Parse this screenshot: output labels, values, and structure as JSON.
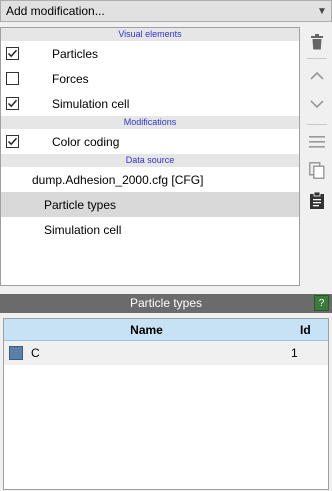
{
  "modifier_dropdown": {
    "label": "Add modification..."
  },
  "pipeline": {
    "visual_header": "Visual elements",
    "visual_items": [
      {
        "label": "Particles",
        "checked": true
      },
      {
        "label": "Forces",
        "checked": false
      },
      {
        "label": "Simulation cell",
        "checked": true
      }
    ],
    "modifications_header": "Modifications",
    "modification_items": [
      {
        "label": "Color coding",
        "checked": true
      }
    ],
    "data_source_header": "Data source",
    "source_file": "dump.Adhesion_2000.cfg [CFG]",
    "source_subitems": [
      {
        "label": "Particle types",
        "selected": true
      },
      {
        "label": "Simulation cell",
        "selected": false
      }
    ]
  },
  "toolbar": {
    "icons": [
      "trash-icon",
      "move-up-icon",
      "move-down-icon",
      "list-menu-icon",
      "copy-icon",
      "clipboard-icon"
    ]
  },
  "panel": {
    "title": "Particle types",
    "help_label": "?"
  },
  "types_table": {
    "headers": {
      "name": "Name",
      "id": "Id"
    },
    "rows": [
      {
        "name": "C",
        "id": "1",
        "color": "#5b7fa6"
      }
    ]
  },
  "colors": {
    "section_text": "#3333cc",
    "panel_title_bg": "#6b6b6b",
    "help_bg": "#3a7a3a",
    "table_header_bg": "#c8e2f5",
    "selected_row_bg": "#d9d9d9"
  }
}
